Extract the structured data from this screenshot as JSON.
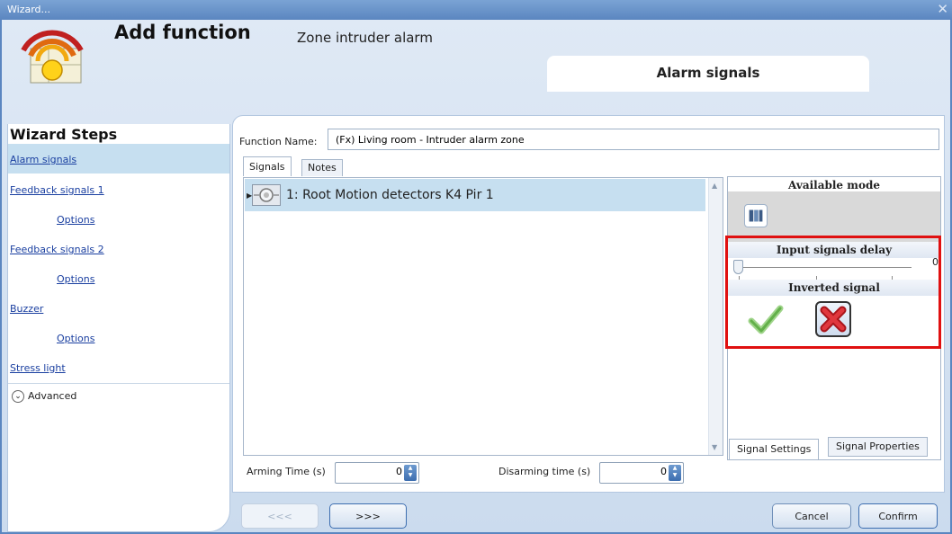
{
  "window": {
    "title": "Wizard...",
    "close_glyph": "✕"
  },
  "header": {
    "title": "Add function",
    "subtitle": "Zone intruder alarm",
    "current_step": "Alarm signals"
  },
  "sidebar": {
    "heading": "Wizard Steps",
    "items": [
      {
        "label": "Alarm signals",
        "active": true
      },
      {
        "label": "Feedback signals 1"
      },
      {
        "label": "Options"
      },
      {
        "label": "Feedback signals 2"
      },
      {
        "label": "Options"
      },
      {
        "label": "Buzzer"
      },
      {
        "label": "Options"
      },
      {
        "label": "Stress light"
      }
    ],
    "advanced_label": "Advanced"
  },
  "form": {
    "function_name_label": "Function Name:",
    "function_name_value": "(Fx) Living room - Intruder alarm zone"
  },
  "tabs": [
    "Signals",
    "Notes"
  ],
  "signals": [
    {
      "label": "1: Root Motion detectors K4 Pir 1"
    }
  ],
  "properties": {
    "available_mode_label": "Available mode",
    "input_delay_label": "Input signals delay",
    "input_delay_value": "0",
    "inverted_label": "Inverted signal",
    "inverted": false
  },
  "prop_tabs": [
    "Signal Settings",
    "Signal Properties"
  ],
  "timing": {
    "arming_label": "Arming Time (s)",
    "arming_value": "0",
    "disarming_label": "Disarming time (s)",
    "disarming_value": "0"
  },
  "buttons": {
    "back": "<<<",
    "next": ">>>",
    "cancel": "Cancel",
    "confirm": "Confirm"
  },
  "colors": {
    "accent": "#5b86c0",
    "highlight_box": "#e01010",
    "selected_row": "#c6dff0"
  }
}
